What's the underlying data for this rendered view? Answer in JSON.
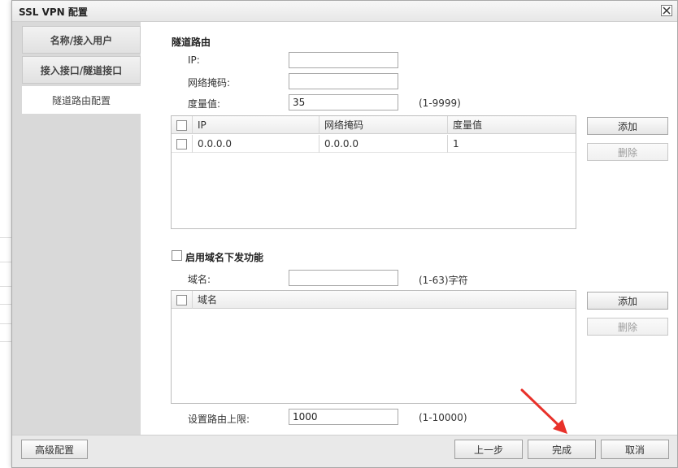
{
  "dialog": {
    "title": "SSL VPN 配置",
    "close_icon": "close-icon"
  },
  "nav": {
    "items": [
      {
        "label": "名称/接入用户",
        "active": false
      },
      {
        "label": "接入接口/隧道接口",
        "active": false
      },
      {
        "label": "隧道路由配置",
        "active": true
      }
    ]
  },
  "tunnel_route": {
    "section_title": "隧道路由",
    "ip_label": "IP:",
    "ip_value": "",
    "mask_label": "网络掩码:",
    "mask_value": "",
    "metric_label": "度量值:",
    "metric_value": "35",
    "metric_hint": "(1-9999)",
    "table": {
      "columns": [
        "IP",
        "网络掩码",
        "度量值"
      ],
      "rows": [
        [
          "0.0.0.0",
          "0.0.0.0",
          "1"
        ]
      ]
    },
    "add_label": "添加",
    "delete_label": "删除"
  },
  "domain": {
    "enable_label": "启用域名下发功能",
    "enabled": false,
    "domain_label": "域名:",
    "domain_value": "",
    "domain_hint": "(1-63)字符",
    "table": {
      "columns": [
        "域名"
      ],
      "rows": []
    },
    "add_label": "添加",
    "delete_label": "删除"
  },
  "route_limit": {
    "label": "设置路由上限:",
    "value": "1000",
    "hint": "(1-10000)"
  },
  "footer": {
    "advanced_label": "高级配置",
    "prev_label": "上一步",
    "finish_label": "完成",
    "cancel_label": "取消"
  },
  "colors": {
    "annotation_arrow": "#e8312a"
  }
}
